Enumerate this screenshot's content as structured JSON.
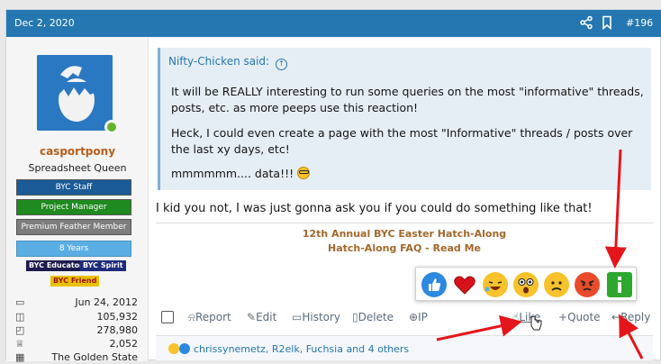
{
  "header": {
    "date": "Dec 2, 2020",
    "post_number": "#196",
    "share_icon": "share-icon",
    "bookmark_icon": "bookmark-icon"
  },
  "user": {
    "name": "casportpony",
    "title": "Spreadsheet Queen",
    "banners": [
      "BYC Staff",
      "Project Manager",
      "Premium Feather Member",
      "8 Years"
    ],
    "tags": [
      "BYC Educator",
      "BYC Spirit",
      "BYC Friend"
    ],
    "stats": [
      {
        "icon": "joined-icon",
        "value": "Jun 24, 2012"
      },
      {
        "icon": "messages-icon",
        "value": "105,932"
      },
      {
        "icon": "reaction-score-icon",
        "value": "278,980"
      },
      {
        "icon": "points-icon",
        "value": "2,052"
      },
      {
        "icon": "location-icon",
        "value": "The Golden State"
      }
    ]
  },
  "quote": {
    "attribution": "Nifty-Chicken said:",
    "paragraphs": [
      "It will be REALLY interesting to run some queries on the most \"informative\" threads, posts, etc. as more peeps use this reaction!",
      "Heck, I could even create a page with the most \"Informative\" threads / posts over the last xy days, etc!",
      "mmmmmm.... data!!! "
    ]
  },
  "reply_text": "I kid you not, I was just gonna ask you if you could do something like that!",
  "signature": [
    "12th Annual BYC Easter Hatch-Along",
    "Hatch-Along FAQ - Read Me"
  ],
  "reactions": [
    "like",
    "love",
    "haha",
    "wow",
    "sad",
    "angry",
    "informative"
  ],
  "actions": {
    "report": "Report",
    "edit": "Edit",
    "history": "History",
    "delete": "Delete",
    "ip": "IP",
    "like": "Like",
    "quote": "Quote",
    "reply": "Reply"
  },
  "reaction_summary": "chrissynemetz, R2elk, Fuchsia and 4 others",
  "colors": {
    "header_bg": "#2577b1",
    "annotation_arrows": "#e5161b"
  }
}
